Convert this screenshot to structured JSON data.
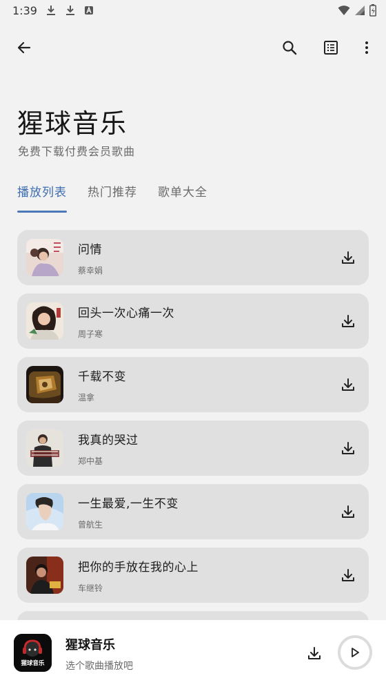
{
  "status_bar": {
    "time": "1:39"
  },
  "header": {
    "title": "猩球音乐",
    "subtitle": "免费下载付费会员歌曲"
  },
  "tabs": [
    {
      "label": "播放列表",
      "active": true
    },
    {
      "label": "热门推荐",
      "active": false
    },
    {
      "label": "歌单大全",
      "active": false
    }
  ],
  "songs": [
    {
      "title": "问情",
      "artist": "蔡幸娟"
    },
    {
      "title": "回头一次心痛一次",
      "artist": "周子寒"
    },
    {
      "title": "千载不变",
      "artist": "温拿"
    },
    {
      "title": "我真的哭过",
      "artist": "郑中基"
    },
    {
      "title": "一生最爱,一生不变",
      "artist": "曾航生"
    },
    {
      "title": "把你的手放在我的心上",
      "artist": "车继铃"
    }
  ],
  "player": {
    "title": "猩球音乐",
    "subtitle": "选个歌曲播放吧",
    "art_text": "猩球音乐"
  },
  "colors": {
    "accent": "#4a78b8",
    "background": "#f2f2f2",
    "card": "#e0e0e0"
  },
  "icons": [
    "back-arrow-icon",
    "search-icon",
    "list-icon",
    "more-vert-icon",
    "download-icon",
    "play-icon"
  ]
}
